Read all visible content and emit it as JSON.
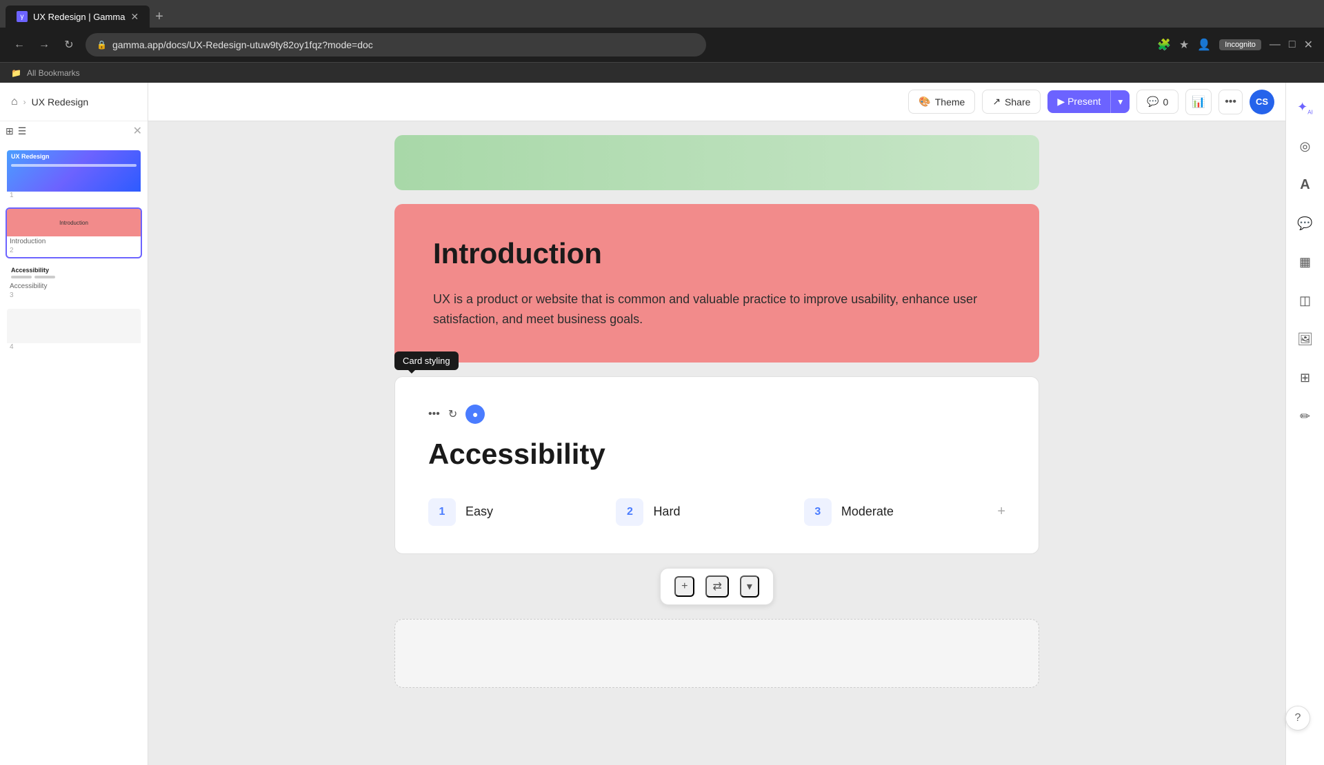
{
  "browser": {
    "tab_title": "UX Redesign | Gamma",
    "url": "gamma.app/docs/UX-Redesign-utuw9ty82oy1fqz?mode=doc",
    "incognito_label": "Incognito",
    "bookmarks_label": "All Bookmarks"
  },
  "header": {
    "home_icon": "⌂",
    "breadcrumb_separator": "›",
    "breadcrumb_label": "UX Redesign",
    "theme_label": "Theme",
    "share_label": "Share",
    "present_label": "Present",
    "comments_label": "0",
    "avatar_initials": "CS"
  },
  "sidebar": {
    "slides": [
      {
        "number": "1",
        "label": "UX Redesign"
      },
      {
        "number": "2",
        "label": "Introduction"
      },
      {
        "number": "3",
        "label": "Accessibility"
      },
      {
        "number": "4",
        "label": ""
      }
    ]
  },
  "intro_card": {
    "title": "Introduction",
    "body": "UX is a product or website that is common and valuable practice to improve usability, enhance user satisfaction, and meet business goals."
  },
  "card_styling_tooltip": "Card styling",
  "accessibility_card": {
    "title": "Accessibility",
    "items": [
      {
        "number": "1",
        "label": "Easy"
      },
      {
        "number": "2",
        "label": "Hard"
      },
      {
        "number": "3",
        "label": "Moderate"
      }
    ],
    "add_icon": "+"
  },
  "bottom_toolbar": {
    "add_icon": "+",
    "layout_icon": "⇄",
    "dropdown_icon": "▾"
  },
  "right_sidebar": {
    "ai_icon": "✦",
    "style_icon": "◎",
    "text_icon": "A",
    "comment_icon": "💬",
    "layout_icon": "▦",
    "layers_icon": "◫",
    "image_icon": "🖼",
    "table_icon": "⊞",
    "edit_icon": "✏"
  },
  "help": {
    "icon": "?"
  }
}
